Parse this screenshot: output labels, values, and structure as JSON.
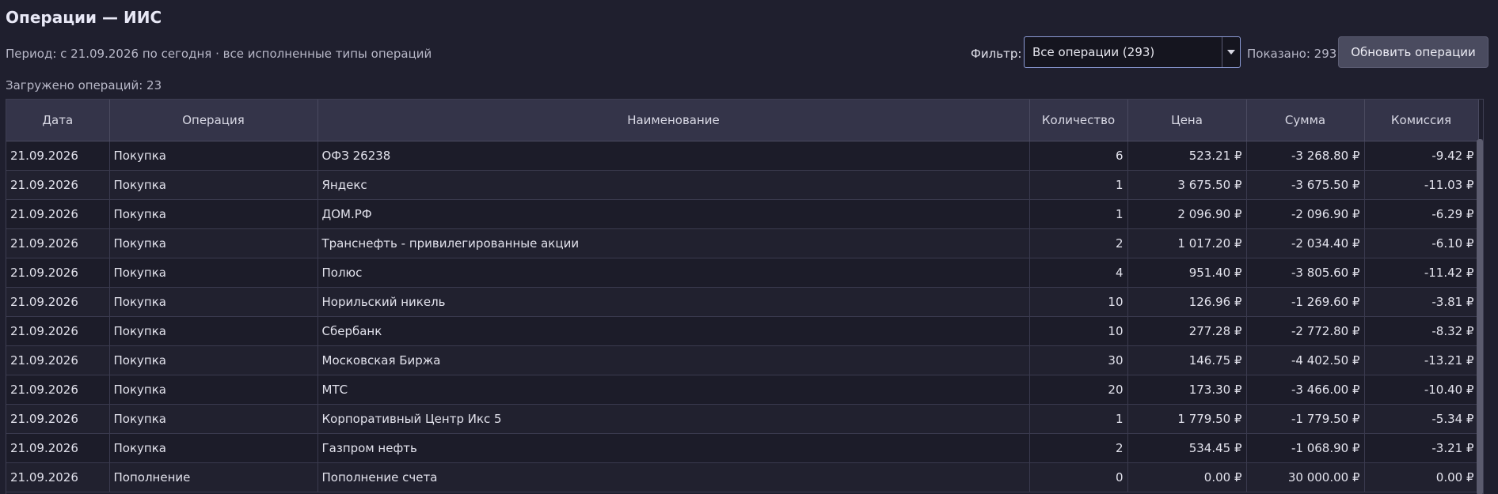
{
  "header": {
    "title": "Операции — ИИС",
    "period": "Период: с 21.09.2026 по сегодня · все исполненные типы операций",
    "loaded": "Загружено операций: 23"
  },
  "toolbar": {
    "filter_label": "Фильтр:",
    "filter_value": "Все операции (293)",
    "shown": "Показано: 293",
    "refresh_label": "Обновить операции"
  },
  "table": {
    "columns": [
      "Дата",
      "Операция",
      "Наименование",
      "Количество",
      "Цена",
      "Сумма",
      "Комиссия"
    ],
    "rows": [
      [
        "21.09.2026",
        "Покупка",
        "ОФЗ 26238",
        "6",
        "523.21 ₽",
        "-3 268.80 ₽",
        "-9.42 ₽"
      ],
      [
        "21.09.2026",
        "Покупка",
        "Яндекс",
        "1",
        "3 675.50 ₽",
        "-3 675.50 ₽",
        "-11.03 ₽"
      ],
      [
        "21.09.2026",
        "Покупка",
        "ДОМ.РФ",
        "1",
        "2 096.90 ₽",
        "-2 096.90 ₽",
        "-6.29 ₽"
      ],
      [
        "21.09.2026",
        "Покупка",
        "Транснефть - привилегированные акции",
        "2",
        "1 017.20 ₽",
        "-2 034.40 ₽",
        "-6.10 ₽"
      ],
      [
        "21.09.2026",
        "Покупка",
        "Полюс",
        "4",
        "951.40 ₽",
        "-3 805.60 ₽",
        "-11.42 ₽"
      ],
      [
        "21.09.2026",
        "Покупка",
        "Норильский никель",
        "10",
        "126.96 ₽",
        "-1 269.60 ₽",
        "-3.81 ₽"
      ],
      [
        "21.09.2026",
        "Покупка",
        "Сбербанк",
        "10",
        "277.28 ₽",
        "-2 772.80 ₽",
        "-8.32 ₽"
      ],
      [
        "21.09.2026",
        "Покупка",
        "Московская Биржа",
        "30",
        "146.75 ₽",
        "-4 402.50 ₽",
        "-13.21 ₽"
      ],
      [
        "21.09.2026",
        "Покупка",
        "МТС",
        "20",
        "173.30 ₽",
        "-3 466.00 ₽",
        "-10.40 ₽"
      ],
      [
        "21.09.2026",
        "Покупка",
        "Корпоративный Центр Икс 5",
        "1",
        "1 779.50 ₽",
        "-1 779.50 ₽",
        "-5.34 ₽"
      ],
      [
        "21.09.2026",
        "Покупка",
        "Газпром нефть",
        "2",
        "534.45 ₽",
        "-1 068.90 ₽",
        "-3.21 ₽"
      ],
      [
        "21.09.2026",
        "Пополнение",
        "Пополнение счета",
        "0",
        "0.00 ₽",
        "30 000.00 ₽",
        "0.00 ₽"
      ]
    ]
  },
  "colors": {
    "background": "#1f1f2e",
    "header_row": "#343449",
    "accent_border": "#8c9bd6",
    "button": "#4a4b5f"
  }
}
